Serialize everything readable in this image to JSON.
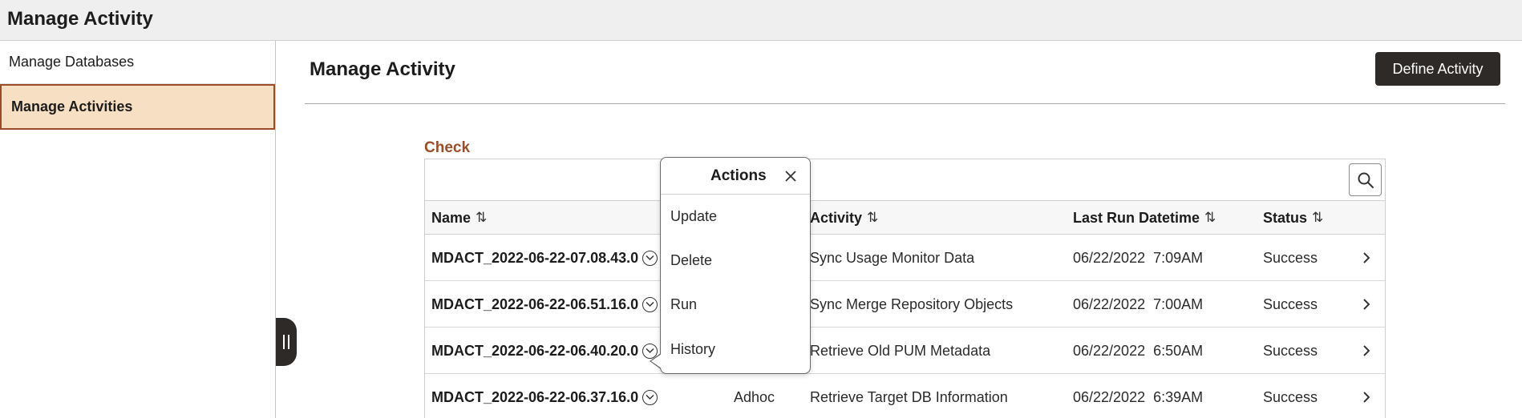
{
  "app": {
    "title": "Manage Activity"
  },
  "sidebar": {
    "items": [
      {
        "label": "Manage Databases"
      },
      {
        "label": "Manage Activities"
      }
    ]
  },
  "main": {
    "title": "Manage Activity",
    "define_button": "Define Activity",
    "section_label": "Check"
  },
  "grid": {
    "columns": [
      {
        "label": "Name"
      },
      {
        "label": "Activity"
      },
      {
        "label": "Last Run Datetime"
      },
      {
        "label": "Status"
      }
    ],
    "sort_glyph": "⇅",
    "rows": [
      {
        "name": "MDACT_2022-06-22-07.08.43.0",
        "type": "",
        "activity": "Sync Usage Monitor Data",
        "datetime": "06/22/2022  7:09AM",
        "status": "Success"
      },
      {
        "name": "MDACT_2022-06-22-06.51.16.0",
        "type": "",
        "activity": "Sync Merge Repository Objects",
        "datetime": "06/22/2022  7:00AM",
        "status": "Success"
      },
      {
        "name": "MDACT_2022-06-22-06.40.20.0",
        "type": "",
        "activity": "Retrieve Old PUM Metadata",
        "datetime": "06/22/2022  6:50AM",
        "status": "Success"
      },
      {
        "name": "MDACT_2022-06-22-06.37.16.0",
        "type": "Adhoc",
        "activity": "Retrieve Target DB Information",
        "datetime": "06/22/2022  6:39AM",
        "status": "Success"
      }
    ]
  },
  "actions_popup": {
    "title": "Actions",
    "items": [
      {
        "label": "Update"
      },
      {
        "label": "Delete"
      },
      {
        "label": "Run"
      },
      {
        "label": "History"
      }
    ]
  },
  "colors": {
    "accent": "#9c4d28",
    "selected_bg": "#f6dfc2",
    "dark_button": "#2d2a27"
  }
}
